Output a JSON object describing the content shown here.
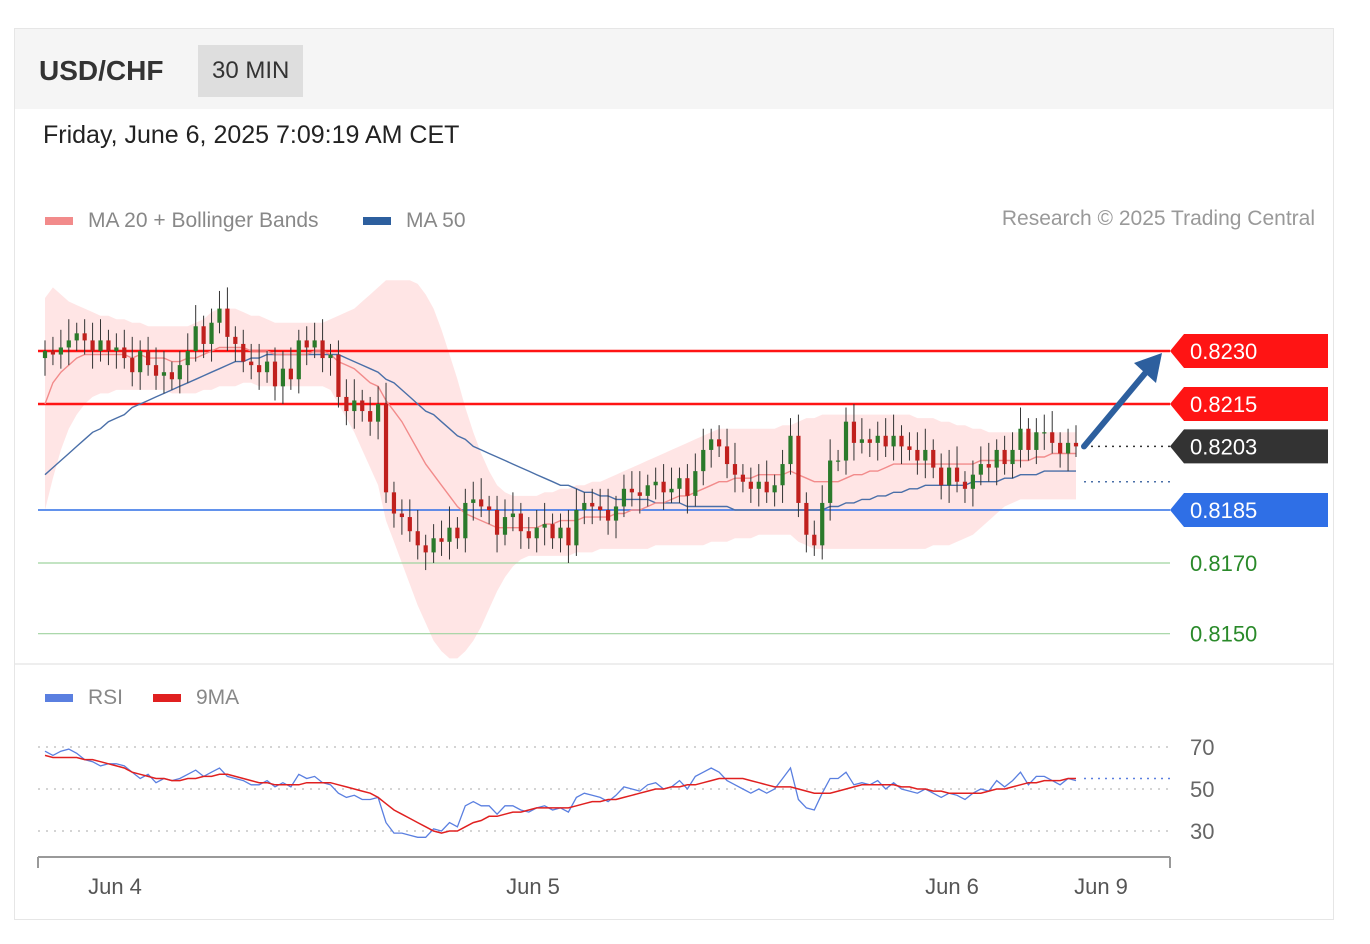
{
  "header": {
    "symbol": "USD/CHF",
    "timeframe": "30 MIN"
  },
  "timestamp": "Friday, June 6, 2025 7:09:19 AM CET",
  "legend": {
    "ma20": {
      "label": "MA 20 + Bollinger Bands",
      "color": "#f28b8b"
    },
    "ma50": {
      "label": "MA 50",
      "color": "#2d5f9e"
    },
    "credit": "Research © 2025 Trading Central"
  },
  "rsi_legend": {
    "rsi": {
      "label": "RSI",
      "color": "#5a7fe0"
    },
    "ma9": {
      "label": "9MA",
      "color": "#e02020"
    }
  },
  "chart_data": [
    {
      "type": "candlestick",
      "title": "USD/CHF 30 MIN",
      "x_tick_labels": [
        "Jun 4",
        "Jun 5",
        "Jun 6",
        "Jun 9"
      ],
      "levels": [
        {
          "value": 0.823,
          "label": "0.8230",
          "kind": "resistance",
          "color": "#ff1414"
        },
        {
          "value": 0.8215,
          "label": "0.8215",
          "kind": "resistance",
          "color": "#ff1414"
        },
        {
          "value": 0.8203,
          "label": "0.8203",
          "kind": "last price",
          "color": "#333333"
        },
        {
          "value": 0.8185,
          "label": "0.8185",
          "kind": "pivot",
          "color": "#2f6fe6"
        },
        {
          "value": 0.817,
          "label": "0.8170",
          "kind": "support",
          "color": "#2a8a2a"
        },
        {
          "value": 0.815,
          "label": "0.8150",
          "kind": "support",
          "color": "#2a8a2a"
        }
      ],
      "bullish_up": "#2b7a2b",
      "bearish_down": "#c0201d",
      "arrow_target": 0.823,
      "ylim": [
        0.813,
        0.826
      ],
      "close": [
        0.823,
        0.8229,
        0.8231,
        0.8233,
        0.8235,
        0.8233,
        0.823,
        0.8233,
        0.823,
        0.8231,
        0.8228,
        0.8224,
        0.823,
        0.8226,
        0.8223,
        0.8224,
        0.8222,
        0.8226,
        0.823,
        0.8237,
        0.8232,
        0.8238,
        0.8242,
        0.8234,
        0.8232,
        0.8227,
        0.8226,
        0.8224,
        0.8227,
        0.822,
        0.8225,
        0.8222,
        0.8233,
        0.8231,
        0.8233,
        0.8228,
        0.8229,
        0.8217,
        0.8213,
        0.8216,
        0.8213,
        0.821,
        0.8215,
        0.819,
        0.8184,
        0.8183,
        0.8179,
        0.8175,
        0.8173,
        0.8177,
        0.8176,
        0.818,
        0.8177,
        0.8187,
        0.8188,
        0.8186,
        0.8185,
        0.8178,
        0.8183,
        0.8184,
        0.8179,
        0.8177,
        0.818,
        0.8181,
        0.8177,
        0.818,
        0.8175,
        0.8185,
        0.8187,
        0.8186,
        0.8185,
        0.8182,
        0.8186,
        0.8191,
        0.819,
        0.8189,
        0.8192,
        0.8193,
        0.819,
        0.8191,
        0.8194,
        0.8189,
        0.8196,
        0.8202,
        0.8205,
        0.8203,
        0.8198,
        0.8195,
        0.8193,
        0.8191,
        0.8193,
        0.819,
        0.8192,
        0.8198,
        0.8206,
        0.8187,
        0.8178,
        0.8175,
        0.8187,
        0.8199,
        0.8199,
        0.821,
        0.8204,
        0.8205,
        0.8204,
        0.8206,
        0.8203,
        0.8206,
        0.8203,
        0.8202,
        0.8199,
        0.8202,
        0.8197,
        0.8192,
        0.8197,
        0.8193,
        0.8191,
        0.8195,
        0.8198,
        0.8197,
        0.8202,
        0.8198,
        0.8202,
        0.8208,
        0.8202,
        0.8207,
        0.8207,
        0.8204,
        0.8201,
        0.8204,
        0.8203
      ],
      "ma20": [
        0.8215,
        0.8221,
        0.8224,
        0.8226,
        0.8228,
        0.8229,
        0.8229,
        0.8229,
        0.8229,
        0.8229,
        0.8229,
        0.8228,
        0.8229,
        0.8228,
        0.8228,
        0.8228,
        0.8227,
        0.8227,
        0.8228,
        0.8228,
        0.8229,
        0.823,
        0.8231,
        0.8231,
        0.8231,
        0.8231,
        0.823,
        0.823,
        0.823,
        0.8229,
        0.8229,
        0.8229,
        0.8229,
        0.8229,
        0.823,
        0.823,
        0.8229,
        0.8227,
        0.8226,
        0.8225,
        0.8223,
        0.8221,
        0.822,
        0.8216,
        0.8213,
        0.821,
        0.8206,
        0.8202,
        0.8198,
        0.8195,
        0.8192,
        0.8189,
        0.8186,
        0.8184,
        0.8183,
        0.8182,
        0.8181,
        0.818,
        0.818,
        0.818,
        0.818,
        0.818,
        0.818,
        0.8181,
        0.8181,
        0.8182,
        0.8182,
        0.8182,
        0.8183,
        0.8183,
        0.8183,
        0.8183,
        0.8184,
        0.8184,
        0.8185,
        0.8185,
        0.8186,
        0.8187,
        0.8187,
        0.8188,
        0.8189,
        0.8189,
        0.819,
        0.8191,
        0.8192,
        0.8193,
        0.8193,
        0.8194,
        0.8194,
        0.8194,
        0.8195,
        0.8195,
        0.8195,
        0.8195,
        0.8196,
        0.8195,
        0.8194,
        0.8193,
        0.8193,
        0.8193,
        0.8193,
        0.8194,
        0.8195,
        0.8195,
        0.8196,
        0.8196,
        0.8197,
        0.8198,
        0.8198,
        0.8198,
        0.8198,
        0.8198,
        0.8198,
        0.8198,
        0.8198,
        0.8198,
        0.8198,
        0.8198,
        0.8199,
        0.8199,
        0.8199,
        0.8199,
        0.8199,
        0.8199,
        0.8199,
        0.82,
        0.82,
        0.8201,
        0.8201,
        0.8201,
        0.8201
      ],
      "bb_upper": [
        0.8245,
        0.8248,
        0.8246,
        0.8244,
        0.8243,
        0.8242,
        0.8241,
        0.824,
        0.824,
        0.8239,
        0.8239,
        0.8238,
        0.8238,
        0.8237,
        0.8237,
        0.8237,
        0.8237,
        0.8237,
        0.8237,
        0.8238,
        0.8239,
        0.8241,
        0.8242,
        0.8242,
        0.8242,
        0.8241,
        0.824,
        0.824,
        0.8239,
        0.8238,
        0.8238,
        0.8238,
        0.8238,
        0.8238,
        0.8238,
        0.8238,
        0.8239,
        0.824,
        0.8241,
        0.8242,
        0.8244,
        0.8246,
        0.8248,
        0.825,
        0.825,
        0.825,
        0.825,
        0.8249,
        0.8246,
        0.8242,
        0.8236,
        0.8229,
        0.8222,
        0.8214,
        0.8207,
        0.8201,
        0.8196,
        0.8192,
        0.819,
        0.8189,
        0.8189,
        0.8189,
        0.8189,
        0.819,
        0.819,
        0.8191,
        0.8191,
        0.8192,
        0.8192,
        0.8193,
        0.8193,
        0.8194,
        0.8195,
        0.8196,
        0.8197,
        0.8198,
        0.8199,
        0.82,
        0.8201,
        0.8202,
        0.8203,
        0.8204,
        0.8205,
        0.8206,
        0.8207,
        0.8208,
        0.8208,
        0.8208,
        0.8208,
        0.8208,
        0.8208,
        0.8208,
        0.8208,
        0.8209,
        0.8209,
        0.821,
        0.8211,
        0.8211,
        0.8212,
        0.8212,
        0.8212,
        0.8212,
        0.8212,
        0.8212,
        0.8212,
        0.8212,
        0.8212,
        0.8212,
        0.8212,
        0.8212,
        0.8211,
        0.8211,
        0.8211,
        0.821,
        0.821,
        0.8209,
        0.8209,
        0.8208,
        0.8208,
        0.8207,
        0.8207,
        0.8207,
        0.8207,
        0.8207,
        0.8207,
        0.8207,
        0.8207,
        0.8207,
        0.8207,
        0.8207,
        0.8207
      ],
      "bb_lower": [
        0.8185,
        0.8194,
        0.8202,
        0.8208,
        0.8212,
        0.8215,
        0.8217,
        0.8218,
        0.8218,
        0.8219,
        0.8219,
        0.8219,
        0.8219,
        0.8219,
        0.8219,
        0.8219,
        0.8218,
        0.8218,
        0.8218,
        0.8218,
        0.8219,
        0.8219,
        0.822,
        0.822,
        0.822,
        0.8221,
        0.8221,
        0.822,
        0.822,
        0.822,
        0.822,
        0.822,
        0.822,
        0.822,
        0.822,
        0.822,
        0.8219,
        0.8215,
        0.8211,
        0.8207,
        0.8202,
        0.8197,
        0.8192,
        0.8182,
        0.8176,
        0.817,
        0.8164,
        0.8158,
        0.8153,
        0.8148,
        0.8145,
        0.8143,
        0.8143,
        0.8145,
        0.8148,
        0.8152,
        0.8157,
        0.8162,
        0.8166,
        0.8169,
        0.8171,
        0.8172,
        0.8172,
        0.8172,
        0.8172,
        0.8172,
        0.8172,
        0.8173,
        0.8173,
        0.8173,
        0.8174,
        0.8174,
        0.8174,
        0.8174,
        0.8174,
        0.8174,
        0.8174,
        0.8175,
        0.8175,
        0.8175,
        0.8175,
        0.8175,
        0.8175,
        0.8175,
        0.8176,
        0.8176,
        0.8176,
        0.8177,
        0.8177,
        0.8177,
        0.8178,
        0.8178,
        0.8178,
        0.8178,
        0.8178,
        0.8176,
        0.8175,
        0.8174,
        0.8174,
        0.8174,
        0.8174,
        0.8174,
        0.8174,
        0.8174,
        0.8174,
        0.8174,
        0.8174,
        0.8174,
        0.8174,
        0.8174,
        0.8174,
        0.8174,
        0.8175,
        0.8175,
        0.8175,
        0.8176,
        0.8177,
        0.8178,
        0.818,
        0.8182,
        0.8184,
        0.8186,
        0.8187,
        0.8188,
        0.8188,
        0.8188,
        0.8188,
        0.8188,
        0.8188,
        0.8188,
        0.8188
      ],
      "ma50": [
        0.8195,
        0.8197,
        0.8199,
        0.8201,
        0.8203,
        0.8205,
        0.8207,
        0.8208,
        0.821,
        0.8211,
        0.8212,
        0.8214,
        0.8215,
        0.8216,
        0.8217,
        0.8218,
        0.8219,
        0.822,
        0.8221,
        0.8222,
        0.8223,
        0.8224,
        0.8225,
        0.8226,
        0.8227,
        0.8227,
        0.8228,
        0.8228,
        0.8229,
        0.8229,
        0.8229,
        0.8229,
        0.8229,
        0.8229,
        0.8229,
        0.8229,
        0.8229,
        0.8229,
        0.8228,
        0.8227,
        0.8226,
        0.8225,
        0.8224,
        0.8222,
        0.8221,
        0.8219,
        0.8217,
        0.8215,
        0.8213,
        0.8212,
        0.821,
        0.8208,
        0.8206,
        0.8205,
        0.8203,
        0.8202,
        0.8201,
        0.82,
        0.8199,
        0.8198,
        0.8197,
        0.8196,
        0.8195,
        0.8194,
        0.8193,
        0.8192,
        0.8192,
        0.8191,
        0.819,
        0.819,
        0.8189,
        0.8189,
        0.8188,
        0.8188,
        0.8188,
        0.8188,
        0.8188,
        0.8187,
        0.8187,
        0.8187,
        0.8187,
        0.8186,
        0.8186,
        0.8186,
        0.8186,
        0.8186,
        0.8186,
        0.8185,
        0.8185,
        0.8185,
        0.8185,
        0.8185,
        0.8185,
        0.8185,
        0.8185,
        0.8185,
        0.8185,
        0.8185,
        0.8185,
        0.8186,
        0.8186,
        0.8187,
        0.8187,
        0.8188,
        0.8188,
        0.8189,
        0.8189,
        0.819,
        0.819,
        0.8191,
        0.8191,
        0.8192,
        0.8192,
        0.8192,
        0.8192,
        0.8192,
        0.8192,
        0.8193,
        0.8193,
        0.8193,
        0.8193,
        0.8194,
        0.8194,
        0.8195,
        0.8195,
        0.8195,
        0.8196,
        0.8196,
        0.8196,
        0.8196,
        0.8196
      ]
    },
    {
      "type": "line",
      "title": "RSI",
      "y_tick_labels": [
        "70",
        "50",
        "30"
      ],
      "ylim": [
        20,
        80
      ],
      "rsi": [
        68,
        66,
        68,
        69,
        67,
        64,
        63,
        61,
        62,
        62,
        61,
        58,
        55,
        57,
        53,
        55,
        54,
        55,
        57,
        59,
        56,
        58,
        60,
        56,
        55,
        54,
        52,
        52,
        54,
        51,
        53,
        51,
        57,
        55,
        56,
        53,
        52,
        48,
        46,
        47,
        45,
        45,
        46,
        34,
        29,
        29,
        28,
        27,
        27,
        31,
        30,
        34,
        32,
        42,
        44,
        42,
        42,
        38,
        42,
        42,
        40,
        39,
        41,
        42,
        40,
        41,
        39,
        46,
        48,
        47,
        46,
        44,
        47,
        51,
        50,
        49,
        52,
        53,
        50,
        51,
        54,
        50,
        56,
        58,
        60,
        58,
        54,
        52,
        50,
        48,
        50,
        48,
        50,
        55,
        60,
        45,
        41,
        40,
        48,
        55,
        55,
        58,
        52,
        53,
        52,
        54,
        50,
        53,
        50,
        49,
        48,
        50,
        48,
        46,
        48,
        47,
        45,
        48,
        50,
        49,
        54,
        51,
        54,
        58,
        52,
        56,
        56,
        54,
        52,
        55,
        54
      ],
      "ma9": [
        66,
        65,
        65,
        65,
        65,
        64,
        64,
        63,
        62,
        61,
        60,
        58,
        57,
        56,
        55,
        55,
        54,
        54,
        55,
        55,
        56,
        56,
        57,
        57,
        56,
        55,
        54,
        53,
        53,
        52,
        52,
        52,
        52,
        53,
        53,
        53,
        53,
        52,
        51,
        50,
        49,
        48,
        46,
        43,
        40,
        38,
        36,
        34,
        32,
        30,
        29,
        30,
        30,
        32,
        34,
        35,
        37,
        37,
        38,
        39,
        39,
        40,
        41,
        41,
        41,
        41,
        41,
        42,
        43,
        44,
        44,
        45,
        45,
        46,
        47,
        48,
        49,
        50,
        50,
        51,
        51,
        52,
        52,
        53,
        54,
        55,
        55,
        55,
        55,
        54,
        53,
        52,
        51,
        51,
        51,
        50,
        49,
        48,
        48,
        48,
        49,
        50,
        51,
        52,
        52,
        52,
        52,
        52,
        51,
        51,
        50,
        50,
        49,
        49,
        48,
        48,
        48,
        48,
        48,
        49,
        50,
        50,
        51,
        52,
        53,
        53,
        54,
        54,
        54,
        55,
        55
      ]
    }
  ]
}
